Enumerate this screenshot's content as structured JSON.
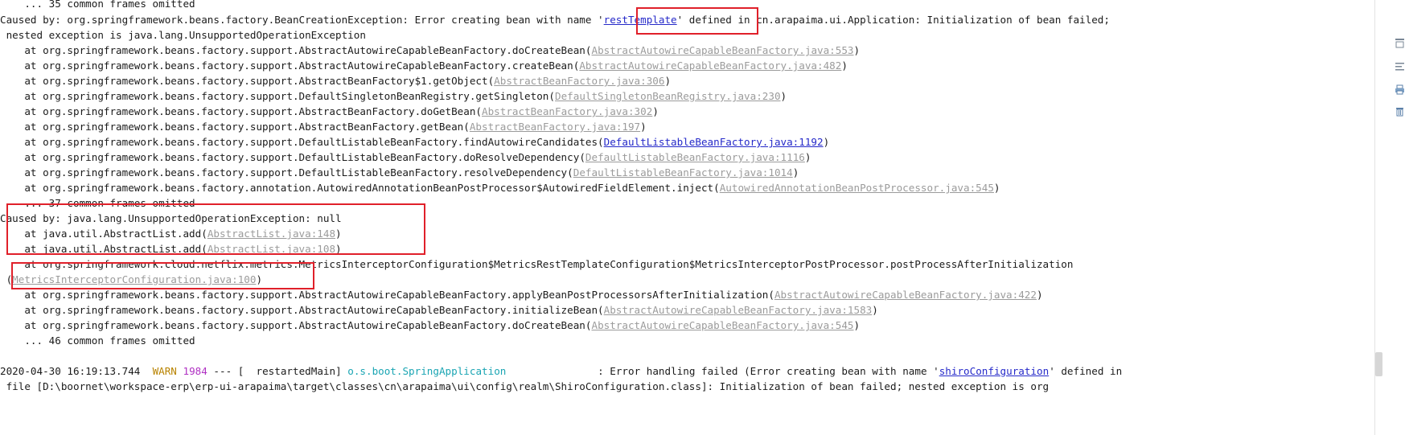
{
  "console": {
    "l0": "    ... 35 common frames omitted",
    "l1": {
      "pre": "Caused by: org.springframework.beans.factory.BeanCreationException: Error creating bean with name '",
      "link": "restTemplate",
      "post": "' defined in cn.arapaima.ui.Application: Initialization of bean failed;"
    },
    "l2": " nested exception is java.lang.UnsupportedOperationException",
    "frames_a": [
      {
        "text": "    at org.springframework.beans.factory.support.AbstractAutowireCapableBeanFactory.doCreateBean",
        "src": "AbstractAutowireCapableBeanFactory.java:553"
      },
      {
        "text": "    at org.springframework.beans.factory.support.AbstractAutowireCapableBeanFactory.createBean",
        "src": "AbstractAutowireCapableBeanFactory.java:482"
      },
      {
        "text": "    at org.springframework.beans.factory.support.AbstractBeanFactory$1.getObject",
        "src": "AbstractBeanFactory.java:306"
      },
      {
        "text": "    at org.springframework.beans.factory.support.DefaultSingletonBeanRegistry.getSingleton",
        "src": "DefaultSingletonBeanRegistry.java:230"
      },
      {
        "text": "    at org.springframework.beans.factory.support.AbstractBeanFactory.doGetBean",
        "src": "AbstractBeanFactory.java:302"
      },
      {
        "text": "    at org.springframework.beans.factory.support.AbstractBeanFactory.getBean",
        "src": "AbstractBeanFactory.java:197"
      },
      {
        "text": "    at org.springframework.beans.factory.support.DefaultListableBeanFactory.findAutowireCandidates",
        "src": "DefaultListableBeanFactory.java:1192"
      },
      {
        "text": "    at org.springframework.beans.factory.support.DefaultListableBeanFactory.doResolveDependency",
        "src": "DefaultListableBeanFactory.java:1116"
      },
      {
        "text": "    at org.springframework.beans.factory.support.DefaultListableBeanFactory.resolveDependency",
        "src": "DefaultListableBeanFactory.java:1014"
      },
      {
        "text": "    at org.springframework.beans.factory.annotation.AutowiredAnnotationBeanPostProcessor$AutowiredFieldElement.inject",
        "src": "AutowiredAnnotationBeanPostProcessor.java:545"
      }
    ],
    "l13": "    ... 37 common frames omitted",
    "l14": "Caused by: java.lang.UnsupportedOperationException: null",
    "frames_b": [
      {
        "text": "    at java.util.AbstractList.add",
        "src": "AbstractList.java:148"
      },
      {
        "text": "    at java.util.AbstractList.add",
        "src": "AbstractList.java:108"
      },
      {
        "text": "    at org.springframework.cloud.netflix.metrics.MetricsInterceptorConfiguration$MetricsRestTemplateConfiguration$MetricsInterceptorPostProcessor.postProcessAfterInitialization",
        "src": ""
      }
    ],
    "l18_src": "MetricsInterceptorConfiguration.java:100",
    "frames_c": [
      {
        "text": "    at org.springframework.beans.factory.support.AbstractAutowireCapableBeanFactory.applyBeanPostProcessorsAfterInitialization",
        "src": "AbstractAutowireCapableBeanFactory.java:422"
      },
      {
        "text": "    at org.springframework.beans.factory.support.AbstractAutowireCapableBeanFactory.initializeBean",
        "src": "AbstractAutowireCapableBeanFactory.java:1583"
      },
      {
        "text": "    at org.springframework.beans.factory.support.AbstractAutowireCapableBeanFactory.doCreateBean",
        "src": "AbstractAutowireCapableBeanFactory.java:545"
      }
    ],
    "l22": "    ... 46 common frames omitted",
    "log": {
      "timestamp": "2020-04-30 16:19:13.744",
      "level": "WARN",
      "pid": "1984",
      "sep": " --- [  restartedMain] ",
      "logger": "o.s.boot.SpringApplication",
      "msg_pre": "               : Error handling failed (Error creating bean with name '",
      "msg_link": "shiroConfiguration",
      "msg_post": "' defined in"
    },
    "l25": " file [D:\\boornet\\workspace-erp\\erp-ui-arapaima\\target\\classes\\cn\\arapaima\\ui\\config\\realm\\ShiroConfiguration.class]: Initialization of bean failed; nested exception is org"
  },
  "side_icons": [
    "scroll-top-icon",
    "soft-wrap-icon",
    "print-icon",
    "trash-icon"
  ],
  "colors": {
    "link_active": "#2529c9",
    "link_muted": "#9b9b9b",
    "warn": "#b88300",
    "pid": "#b031c3",
    "logger": "#1aa5b3",
    "highlight": "#e0202a"
  }
}
